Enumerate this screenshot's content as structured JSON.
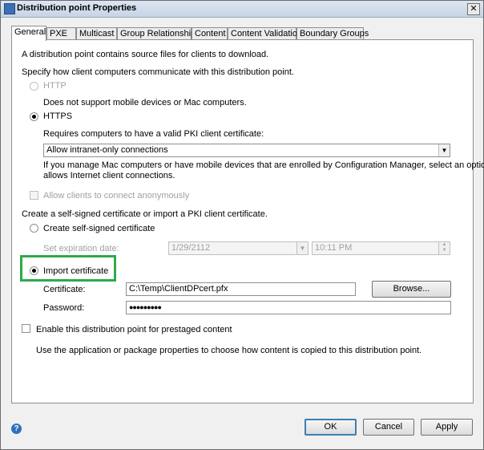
{
  "window": {
    "title": "Distribution point Properties",
    "close_glyph": "✕"
  },
  "tabs": [
    "General",
    "PXE",
    "Multicast",
    "Group Relationships",
    "Content",
    "Content Validation",
    "Boundary Groups"
  ],
  "general": {
    "intro": "A distribution point contains source files for clients to download.",
    "specify_label": "Specify how client computers communicate with this distribution point.",
    "http_label": "HTTP",
    "http_note": "Does not support mobile devices or Mac computers.",
    "https_label": "HTTPS",
    "https_note": "Requires computers to have a valid PKI client certificate:",
    "connection_select_value": "Allow intranet-only connections",
    "mac_note_line1": "If you manage Mac computers or have mobile devices that are enrolled by Configuration Manager, select an option that",
    "mac_note_line2": "allows Internet client connections.",
    "allow_anonymous_label": "Allow clients to connect anonymously",
    "cert_section_label": "Create a self-signed certificate or import a PKI client certificate.",
    "create_selfsigned_label": "Create self-signed certificate",
    "expiration_label": "Set expiration date:",
    "expiration_date": "1/29/2112",
    "expiration_time": "10:11 PM",
    "import_cert_label": "Import certificate",
    "certificate_label": "Certificate:",
    "certificate_value": "C:\\Temp\\ClientDPcert.pfx",
    "browse_label": "Browse...",
    "password_label": "Password:",
    "password_value": "●●●●●●●●●",
    "prestaged_label": "Enable this distribution point for prestaged content",
    "prestaged_note": "Use the application or package properties to choose how content is copied to this distribution point."
  },
  "footer": {
    "ok_label": "OK",
    "cancel_label": "Cancel",
    "apply_label": "Apply",
    "help_glyph": "?"
  },
  "colors": {
    "highlight_box": "#2eaa4a",
    "title_bar": "#c7d4e6"
  },
  "icons": {
    "help": "help-icon",
    "close": "close-icon",
    "app": "app-icon"
  }
}
